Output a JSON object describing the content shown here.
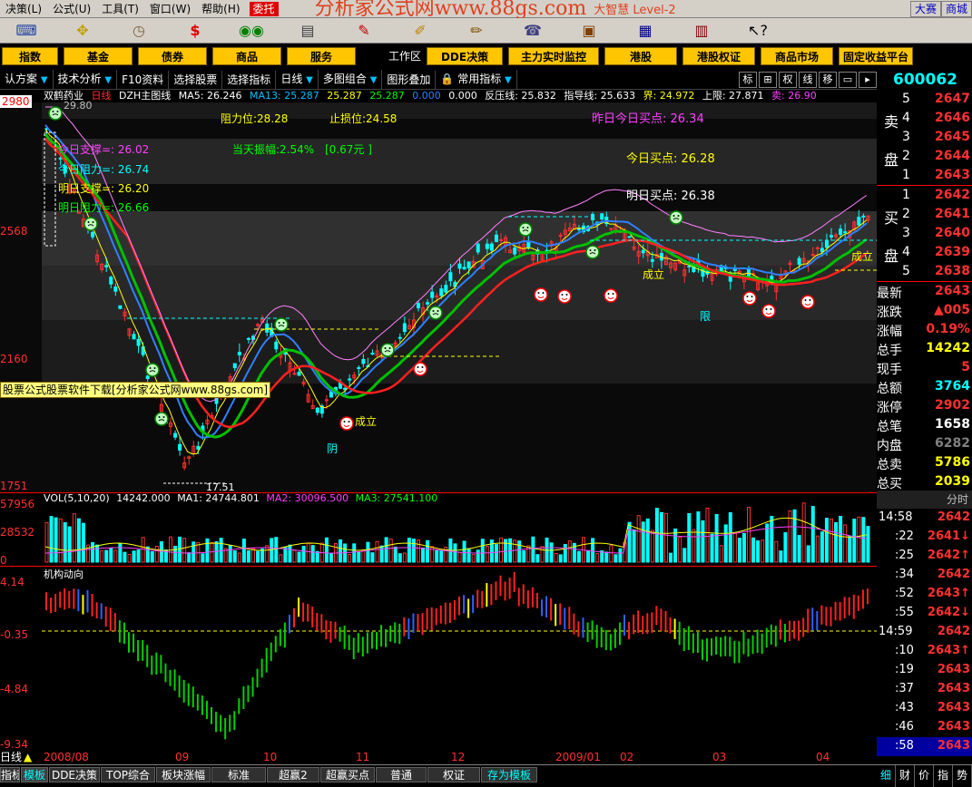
{
  "menu": {
    "items": [
      "决策(L)",
      "公式(U)",
      "工具(T)",
      "窗口(W)",
      "帮助(H)"
    ],
    "weituo": "委托",
    "brand": "分析家公式网www.88gs.com",
    "brand_sub": "大智慧 Level-2",
    "right_buttons": [
      "大赛",
      "商城"
    ]
  },
  "navbar": {
    "buttons": [
      "指数",
      "基金",
      "债券",
      "商品",
      "服务"
    ],
    "workspace": "工作区",
    "right_buttons": [
      "DDE决策",
      "主力实时监控",
      "港股",
      "港股权证",
      "商品市场",
      "固定收益平台"
    ]
  },
  "toolbar": {
    "items": [
      "认方案",
      "技术分析",
      "F10资料",
      "选择股票",
      "选择指标",
      "日线",
      "多图组合",
      "图形叠加",
      "常用指标"
    ],
    "mini_buttons": [
      "标",
      "⊞",
      "权",
      "线",
      "移",
      "▭",
      "▸"
    ],
    "stock_code": "600062 双"
  },
  "chart_header": {
    "stock": "双鹤药业",
    "period": "日线",
    "indicator": "DZH主图线",
    "ma5": "MA5: 26.246",
    "ma13": "MA13: 25.287",
    "v1": "25.287",
    "v2": "25.287",
    "v3": "0.000",
    "v4": "0.000",
    "resistance_line": "反压线: 25.832",
    "guide_line": "指导线: 25.633",
    "boundary": "界: 24.972",
    "upper": "上限: 27.871",
    "sell": "卖: 26.90"
  },
  "annotations": {
    "resistance": "阻力位:28.28",
    "stoploss": "止损位:24.58",
    "yesterday_buy": "昨日今日买点: 26.34",
    "amplitude": "当天振幅:2.54%",
    "amplitude_value": "[0.67元 ]",
    "today_buy": "今日买点: 26.28",
    "tomorrow_buy": "明日买点: 26.38",
    "support1": "今日支撑=: 26.02",
    "resist1": "今日阻力=: 26.74",
    "support2": "明日支撑=: 26.20",
    "resist2": "明日阻力=: 26.66",
    "banner": "股票公式股票软件下载[分析家公式网www.88gs.com]",
    "peak_label": "29.80",
    "low_label": "17.51",
    "chengli": "成立",
    "yin": "阴",
    "xian": "限"
  },
  "price_axis": [
    "2980",
    "2568",
    "2160",
    "1751"
  ],
  "volume": {
    "title": "VOL(5,10,20)",
    "value": "14242.000",
    "ma1": "MA1: 24744.801",
    "ma2": "MA2: 30096.500",
    "ma3": "MA3: 27541.100",
    "axis": [
      "57956",
      "28532",
      "0"
    ]
  },
  "indicator": {
    "title": "机构动向",
    "axis": [
      "4.14",
      "-0.35",
      "-4.84",
      "-9.34"
    ]
  },
  "xaxis": [
    "日线",
    "2008/08",
    "09",
    "10",
    "11",
    "12",
    "2009/01",
    "02",
    "03",
    "04"
  ],
  "orderbook": {
    "sell_label": [
      "卖",
      "盘"
    ],
    "buy_label": [
      "买",
      "盘"
    ],
    "sell": [
      {
        "lv": "5",
        "price": "2647"
      },
      {
        "lv": "4",
        "price": "2646"
      },
      {
        "lv": "3",
        "price": "2645"
      },
      {
        "lv": "2",
        "price": "2644"
      },
      {
        "lv": "1",
        "price": "2643"
      }
    ],
    "buy": [
      {
        "lv": "1",
        "price": "2642"
      },
      {
        "lv": "2",
        "price": "2641"
      },
      {
        "lv": "3",
        "price": "2640"
      },
      {
        "lv": "4",
        "price": "2639"
      },
      {
        "lv": "5",
        "price": "2638"
      }
    ]
  },
  "stats": [
    {
      "k": "最新",
      "v": "2643",
      "c": "#ff3030"
    },
    {
      "k": "涨跌",
      "v": "▲005",
      "c": "#ff3030"
    },
    {
      "k": "涨幅",
      "v": "0.19%",
      "c": "#ff3030"
    },
    {
      "k": "总手",
      "v": "14242",
      "c": "#ffff00"
    },
    {
      "k": "现手",
      "v": "5",
      "c": "#ff3030"
    },
    {
      "k": "总额",
      "v": "3764",
      "c": "#00ffff"
    },
    {
      "k": "涨停",
      "v": "2902",
      "c": "#ff3030"
    },
    {
      "k": "总笔",
      "v": "1658",
      "c": "#ffffff"
    },
    {
      "k": "内盘",
      "v": "6282",
      "c": "#808080"
    },
    {
      "k": "总卖",
      "v": "5786",
      "c": "#ffff00"
    },
    {
      "k": "总买",
      "v": "2039",
      "c": "#ffff00"
    }
  ],
  "ticks_header": "分时",
  "ticks": [
    {
      "t": "14:58",
      "p": "2642"
    },
    {
      "t": ":22",
      "p": "2641↓"
    },
    {
      "t": ":25",
      "p": "2642↑"
    },
    {
      "t": ":34",
      "p": "2642"
    },
    {
      "t": ":52",
      "p": "2643↑"
    },
    {
      "t": ":55",
      "p": "2642↓"
    },
    {
      "t": "14:59",
      "p": "2642"
    },
    {
      "t": ":10",
      "p": "2643↑"
    },
    {
      "t": ":19",
      "p": "2643"
    },
    {
      "t": ":37",
      "p": "2643"
    },
    {
      "t": ":43",
      "p": "2643"
    },
    {
      "t": ":46",
      "p": "2643"
    },
    {
      "t": ":58",
      "p": "2643"
    }
  ],
  "bottom_tabs": [
    "指标",
    "模板",
    "DDE决策",
    "TOP综合",
    "板块涨幅",
    "标准",
    "超赢2",
    "超赢买点",
    "普通",
    "权证",
    "存为模板"
  ],
  "side_bottom": [
    "细",
    "财",
    "价",
    "指",
    "势"
  ],
  "colors": {
    "up": "#ff3030",
    "down": "#00ffff",
    "ma5": "#ffff00",
    "ma13": "#00c000",
    "blue": "#3080ff"
  }
}
